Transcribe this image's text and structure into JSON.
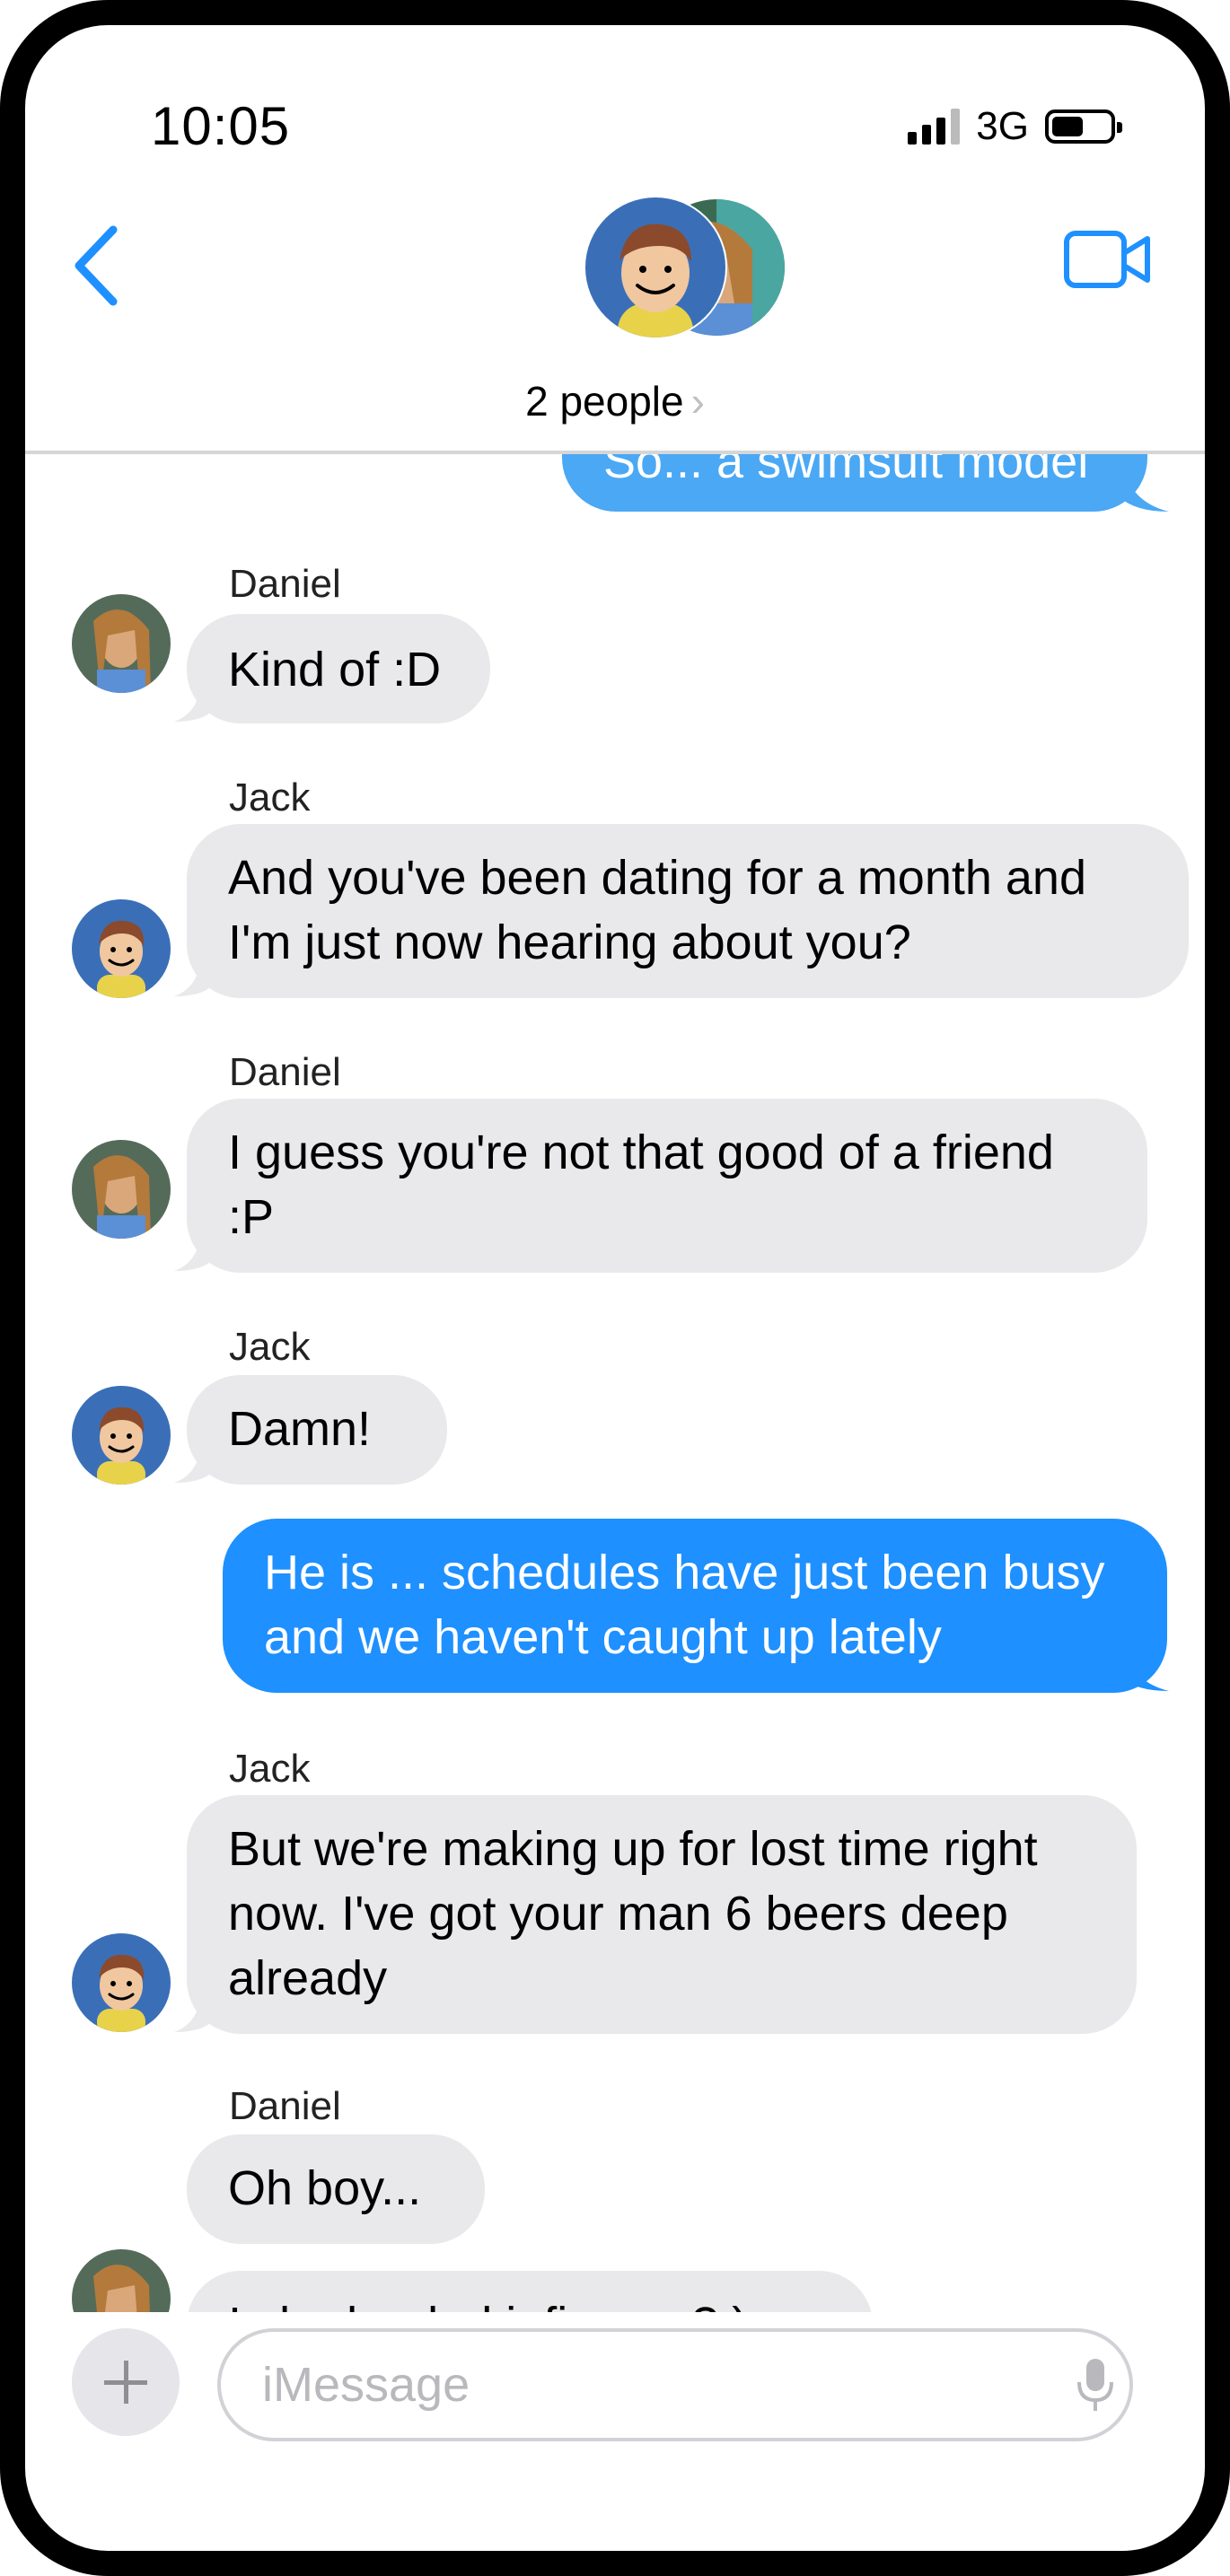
{
  "status_bar": {
    "time": "10:05",
    "network": "3G"
  },
  "header": {
    "people_label": "2 people",
    "chevron": "›"
  },
  "messages": [
    {
      "sender": "",
      "text": "So... a swimsuit model",
      "side": "right"
    },
    {
      "sender": "Daniel",
      "text": "Kind of :D",
      "side": "left"
    },
    {
      "sender": "Jack",
      "text": "And you've been dating for a month and I'm just now hearing about you?",
      "side": "left"
    },
    {
      "sender": "Daniel",
      "text": "I guess you're not that good of a friend :P",
      "side": "left"
    },
    {
      "sender": "Jack",
      "text": "Damn!",
      "side": "left"
    },
    {
      "sender": "",
      "text": "He is ... schedules have just been busy and we haven't caught up lately",
      "side": "right"
    },
    {
      "sender": "Jack",
      "text": "But we're making up for lost time right now.  I've got your man 6 beers deep already",
      "side": "left"
    },
    {
      "sender": "Daniel",
      "text": "Oh boy...",
      "side": "left"
    },
    {
      "sender": "",
      "text": "Is he loaded infirmary?:)",
      "side": "left"
    }
  ],
  "input": {
    "placeholder": "iMessage"
  },
  "colors": {
    "accent": "#1e90ff",
    "bubble_gray": "#e9e9eb"
  },
  "icons": [
    "back-chevron-icon",
    "video-camera-icon",
    "plus-icon",
    "microphone-icon"
  ]
}
